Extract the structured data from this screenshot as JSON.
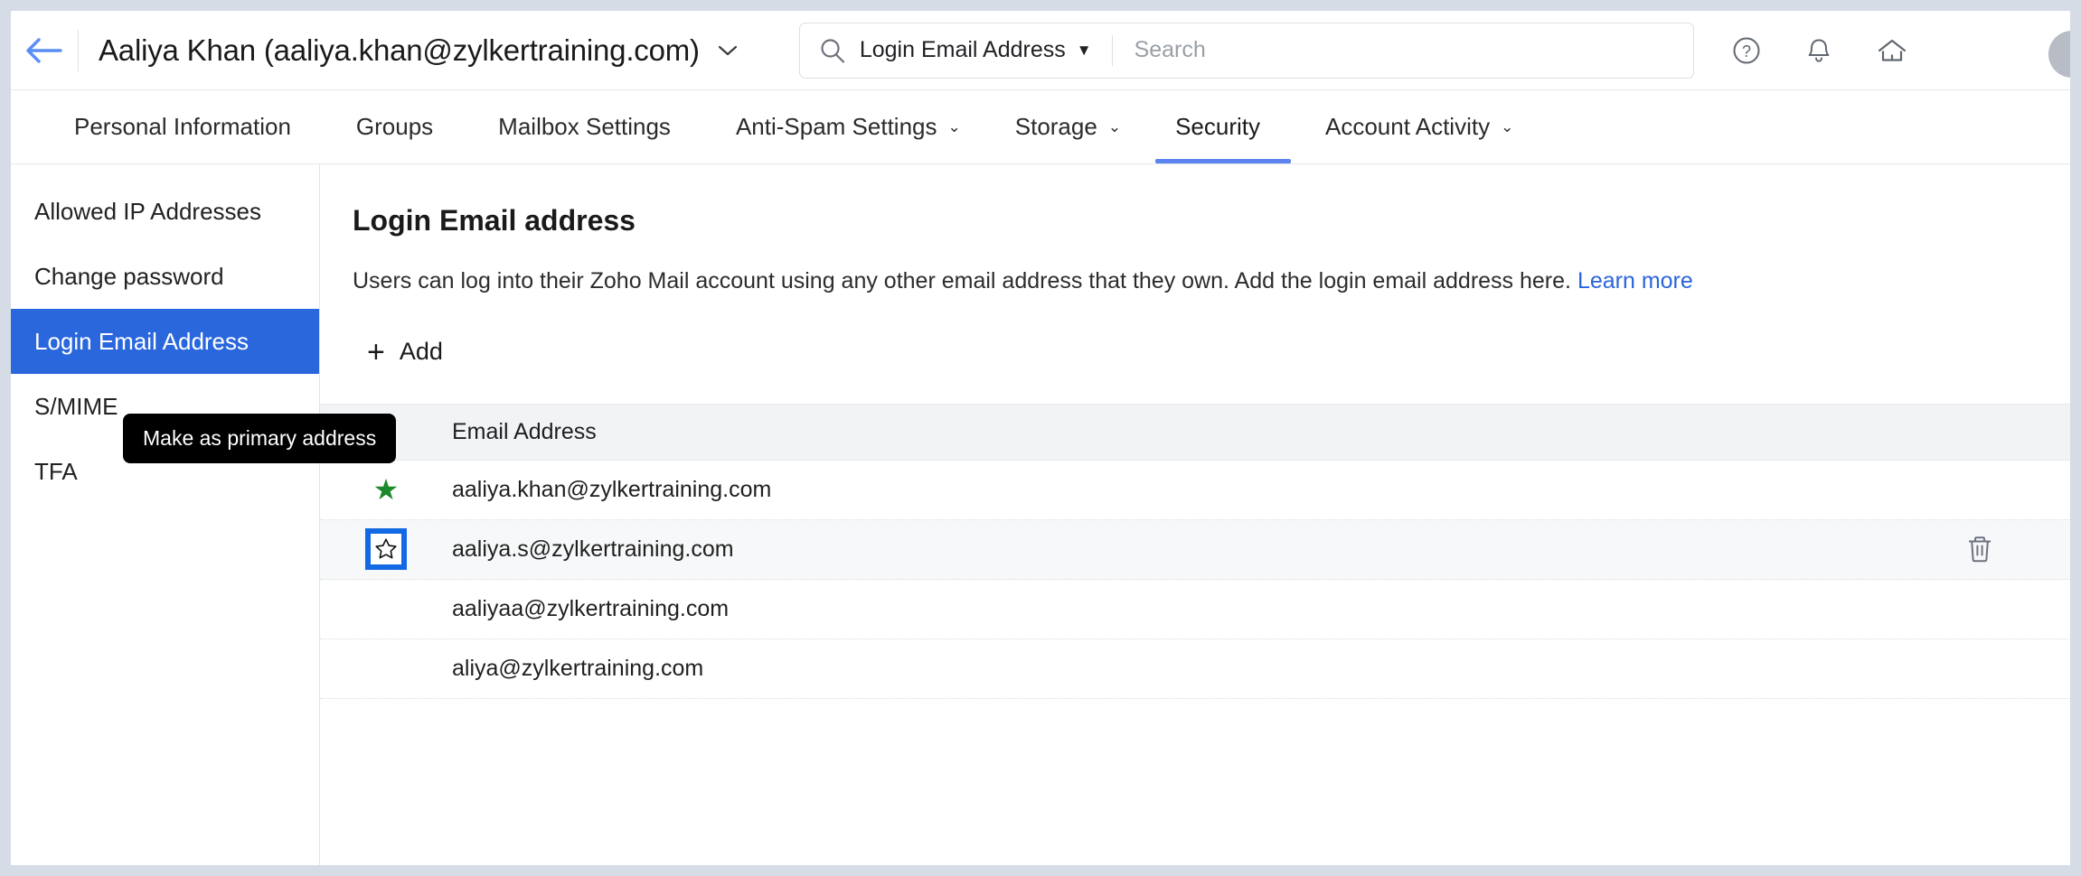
{
  "topbar": {
    "back_icon": "back-arrow-icon",
    "account_title": "Aaliya Khan (aaliya.khan@zylkertraining.com)",
    "account_caret": "⌄",
    "search": {
      "icon": "search-icon",
      "scope_label": "Login Email Address",
      "scope_caret": "▼",
      "placeholder": "Search",
      "value": ""
    },
    "icons": [
      {
        "name": "help-icon",
        "label": "?"
      },
      {
        "name": "notifications-bell-icon",
        "label": ""
      },
      {
        "name": "home-icon",
        "label": ""
      }
    ],
    "avatar": "user-avatar"
  },
  "tabs": [
    {
      "label": "Personal Information",
      "caret": "",
      "active": false
    },
    {
      "label": "Groups",
      "caret": "",
      "active": false
    },
    {
      "label": "Mailbox Settings",
      "caret": "",
      "active": false
    },
    {
      "label": "Anti-Spam Settings",
      "caret": "⌄",
      "active": false
    },
    {
      "label": "Storage",
      "caret": "⌄",
      "active": false
    },
    {
      "label": "Security",
      "caret": "",
      "active": true
    },
    {
      "label": "Account Activity",
      "caret": "⌄",
      "active": false
    }
  ],
  "sidebar": {
    "items": [
      {
        "label": "Allowed IP Addresses",
        "active": false
      },
      {
        "label": "Change password",
        "active": false
      },
      {
        "label": "Login Email Address",
        "active": true
      },
      {
        "label": "S/MIME",
        "active": false
      },
      {
        "label": "TFA",
        "active": false
      }
    ]
  },
  "main": {
    "title": "Login Email address",
    "description": "Users can log into their Zoho Mail account using any other email address that they own. Add the login email address here.",
    "learn_more": "Learn more",
    "add_label": "Add",
    "add_icon": "plus-icon",
    "table": {
      "headers": {
        "star": "",
        "email": "Email Address",
        "actions": ""
      },
      "rows": [
        {
          "email": "aaliya.khan@zylkertraining.com",
          "primary": true,
          "star_icon": "star-filled-icon",
          "delete_icon": "",
          "highlighted": false
        },
        {
          "email": "aaliya.s@zylkertraining.com",
          "primary": false,
          "star_icon": "star-outline-icon",
          "delete_icon": "trash-icon",
          "highlighted": true
        },
        {
          "email": "aaliyaa@zylkertraining.com",
          "primary": false,
          "star_icon": "",
          "delete_icon": "",
          "highlighted": false
        },
        {
          "email": "aliya@zylkertraining.com",
          "primary": false,
          "star_icon": "",
          "delete_icon": "",
          "highlighted": false
        }
      ]
    },
    "tooltip": {
      "text": "Make as primary address"
    }
  },
  "colors": {
    "accent_blue": "#2a67dd",
    "tab_underline": "#5b84f0",
    "link_blue": "#2b64d9",
    "primary_star_green": "#1b8a2a",
    "highlight_box_blue": "#1368e3",
    "page_bg": "#d5dce5"
  }
}
